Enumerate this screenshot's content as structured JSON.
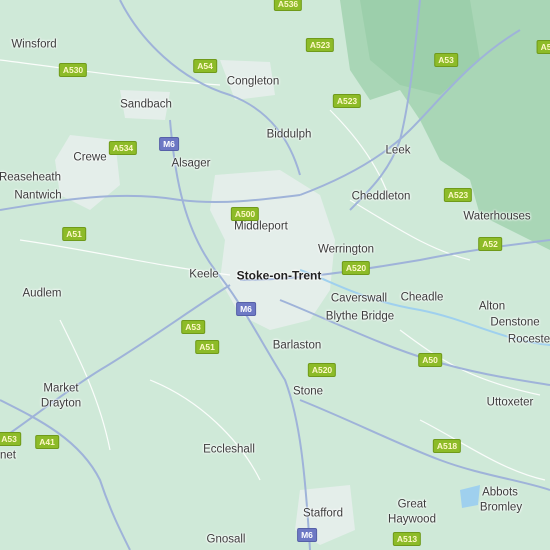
{
  "colors": {
    "land": "#cfe9d8",
    "park": "#a9d6b6",
    "urban": "#e4eeea",
    "road_major": "#9fb3d9",
    "road_minor": "#ffffff",
    "water": "#9fd0ee",
    "shield_a": "#8dbb28",
    "shield_m": "#6d78c4"
  },
  "places": [
    {
      "id": "winsford",
      "name": "Winsford"
    },
    {
      "id": "sandbach",
      "name": "Sandbach"
    },
    {
      "id": "congleton",
      "name": "Congleton"
    },
    {
      "id": "crewe",
      "name": "Crewe"
    },
    {
      "id": "alsager",
      "name": "Alsager"
    },
    {
      "id": "biddulph",
      "name": "Biddulph"
    },
    {
      "id": "leek",
      "name": "Leek"
    },
    {
      "id": "reaseheath",
      "name": "Reaseheath"
    },
    {
      "id": "nantwich",
      "name": "Nantwich"
    },
    {
      "id": "cheddleton",
      "name": "Cheddleton"
    },
    {
      "id": "waterhouses",
      "name": "Waterhouses"
    },
    {
      "id": "middleport",
      "name": "Middleport"
    },
    {
      "id": "werrington",
      "name": "Werrington"
    },
    {
      "id": "keele",
      "name": "Keele"
    },
    {
      "id": "stoke",
      "name": "Stoke-on-Trent"
    },
    {
      "id": "audlem",
      "name": "Audlem"
    },
    {
      "id": "caverswall",
      "name": "Caverswall"
    },
    {
      "id": "cheadle",
      "name": "Cheadle"
    },
    {
      "id": "alton",
      "name": "Alton"
    },
    {
      "id": "denstone",
      "name": "Denstone"
    },
    {
      "id": "rocester",
      "name": "Roceste"
    },
    {
      "id": "blythe",
      "name": "Blythe Bridge"
    },
    {
      "id": "barlaston",
      "name": "Barlaston"
    },
    {
      "id": "market",
      "name": "Market"
    },
    {
      "id": "drayton",
      "name": "Drayton"
    },
    {
      "id": "stone",
      "name": "Stone"
    },
    {
      "id": "uttoxeter",
      "name": "Uttoxeter"
    },
    {
      "id": "et",
      "name": "net"
    },
    {
      "id": "eccleshall",
      "name": "Eccleshall"
    },
    {
      "id": "abbots",
      "name": "Abbots"
    },
    {
      "id": "bromley",
      "name": "Bromley"
    },
    {
      "id": "great",
      "name": "Great"
    },
    {
      "id": "haywood",
      "name": "Haywood"
    },
    {
      "id": "stafford",
      "name": "Stafford"
    },
    {
      "id": "gnosall",
      "name": "Gnosall"
    }
  ],
  "shields": [
    {
      "id": "a536",
      "label": "A536"
    },
    {
      "id": "a523n",
      "label": "A523"
    },
    {
      "id": "a53n",
      "label": "A53"
    },
    {
      "id": "a530",
      "label": "A530"
    },
    {
      "id": "a54",
      "label": "A54"
    },
    {
      "id": "a523m",
      "label": "A523"
    },
    {
      "id": "m6n",
      "label": "M6",
      "kind": "m"
    },
    {
      "id": "a534",
      "label": "A534"
    },
    {
      "id": "a523s",
      "label": "A523"
    },
    {
      "id": "a500",
      "label": "A500"
    },
    {
      "id": "a51w",
      "label": "A51"
    },
    {
      "id": "a542",
      "label": "A52"
    },
    {
      "id": "a520n",
      "label": "A520"
    },
    {
      "id": "m6s",
      "label": "M6",
      "kind": "m"
    },
    {
      "id": "a53s",
      "label": "A53"
    },
    {
      "id": "a51s",
      "label": "A51"
    },
    {
      "id": "a50",
      "label": "A50"
    },
    {
      "id": "a520s",
      "label": "A520"
    },
    {
      "id": "a53sw",
      "label": "A53"
    },
    {
      "id": "a41",
      "label": "A41"
    },
    {
      "id": "a518",
      "label": "A518"
    },
    {
      "id": "m6b",
      "label": "M6",
      "kind": "m"
    },
    {
      "id": "a513",
      "label": "A513"
    },
    {
      "id": "a5e",
      "label": "A5"
    }
  ]
}
